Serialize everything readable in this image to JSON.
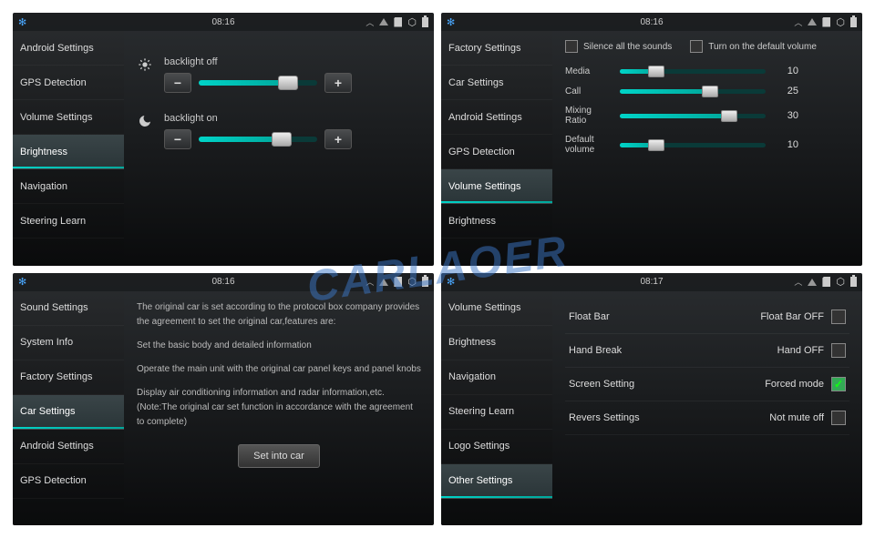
{
  "watermark": "CARLAOER",
  "statusbar": {
    "time1": "08:16",
    "time2": "08:17"
  },
  "p1": {
    "sidebar": [
      "Android Settings",
      "GPS Detection",
      "Volume Settings",
      "Brightness",
      "Navigation",
      "Steering Learn"
    ],
    "active": 3,
    "label_off": "backlight off",
    "label_on": "backlight on",
    "off_pct": 75,
    "on_pct": 70
  },
  "p2": {
    "sidebar": [
      "Factory Settings",
      "Car Settings",
      "Android Settings",
      "GPS Detection",
      "Volume Settings",
      "Brightness"
    ],
    "active": 4,
    "cb1": "Silence all the sounds",
    "cb2": "Turn on the default volume",
    "rows": [
      {
        "label": "Media",
        "val": 10,
        "pct": 25
      },
      {
        "label": "Call",
        "val": 25,
        "pct": 62
      },
      {
        "label": "Mixing Ratio",
        "val": 30,
        "pct": 75
      },
      {
        "label": "Default volume",
        "val": 10,
        "pct": 25
      }
    ]
  },
  "p3": {
    "sidebar": [
      "Sound Settings",
      "System Info",
      "Factory Settings",
      "Car Settings",
      "Android Settings",
      "GPS Detection"
    ],
    "active": 3,
    "desc1": "The original car is set according to the protocol box company provides the agreement to set the original car,features are:",
    "desc2": "Set the basic body and detailed information",
    "desc3": "Operate the main unit with the original car panel keys and panel knobs",
    "desc4": "Display air conditioning information and radar information,etc. (Note:The original car set function in accordance with the agreement to complete)",
    "button": "Set into car"
  },
  "p4": {
    "sidebar": [
      "Volume Settings",
      "Brightness",
      "Navigation",
      "Steering Learn",
      "Logo Settings",
      "Other Settings"
    ],
    "active": 5,
    "rows": [
      {
        "label": "Float Bar",
        "val": "Float Bar OFF",
        "checked": false
      },
      {
        "label": "Hand Break",
        "val": "Hand OFF",
        "checked": false
      },
      {
        "label": "Screen Setting",
        "val": "Forced mode",
        "checked": true
      },
      {
        "label": "Revers Settings",
        "val": "Not mute off",
        "checked": false
      }
    ]
  }
}
